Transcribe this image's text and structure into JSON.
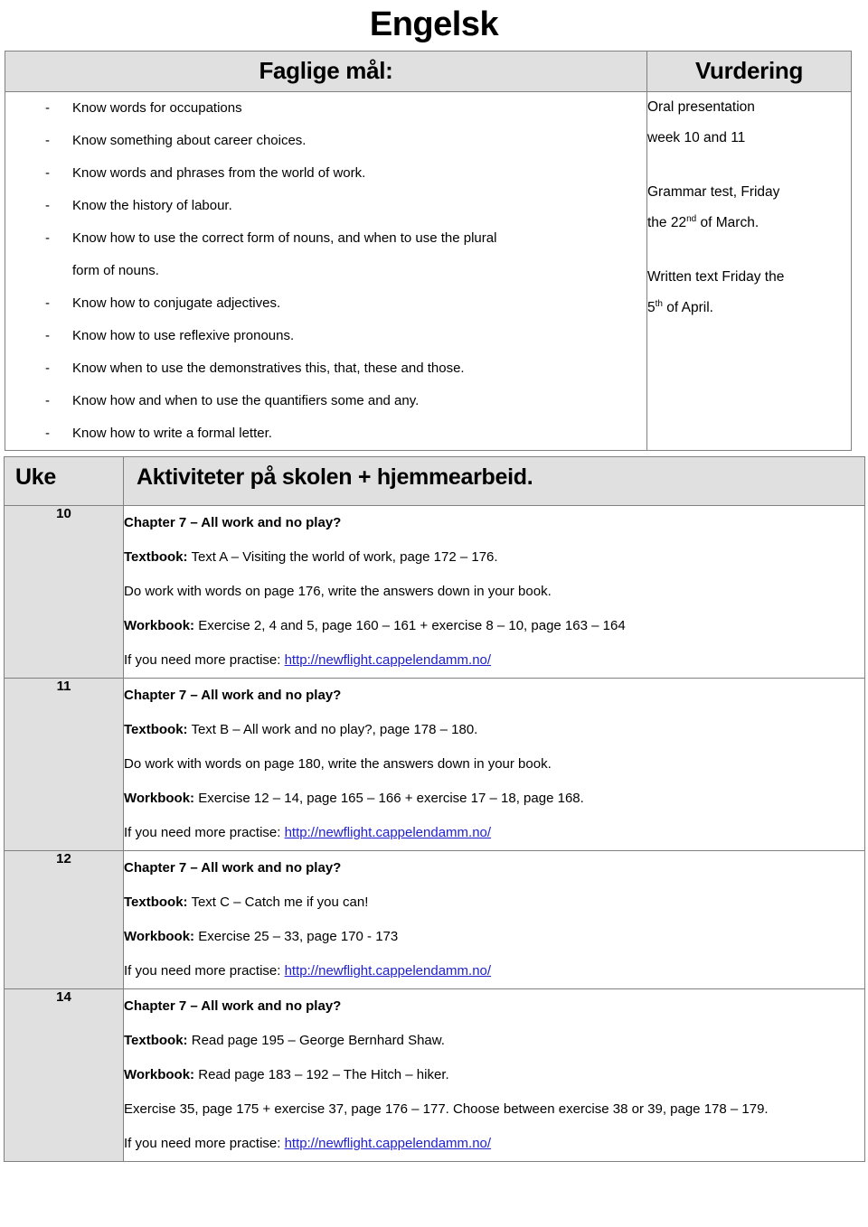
{
  "document": {
    "title": "Engelsk"
  },
  "goals_table": {
    "headers": {
      "goals": "Faglige mål:",
      "assessment": "Vurdering"
    },
    "goals": [
      {
        "text": "Know words for occupations"
      },
      {
        "text": "Know something about career choices."
      },
      {
        "text": "Know words and phrases from the world of work."
      },
      {
        "text": "Know the history of labour."
      },
      {
        "text": "Know how to use the correct form of nouns, and when to use the plural",
        "continuation": "form of nouns."
      },
      {
        "text": "Know how to conjugate adjectives."
      },
      {
        "text": "Know how to use reflexive pronouns."
      },
      {
        "text": "Know when to use the demonstratives this, that, these and those."
      },
      {
        "text": "Know how and when to use the quantifiers some and any."
      },
      {
        "text": "Know how to write a formal letter."
      }
    ],
    "assessments": [
      {
        "line1": "Oral presentation",
        "line2": "week 10 and 11"
      },
      {
        "line1": "Grammar test, Friday",
        "line2_pre": "the 22",
        "line2_sup": "nd",
        "line2_post": " of March."
      },
      {
        "line1": "Written text Friday the",
        "line2_pre": "5",
        "line2_sup": "th",
        "line2_post": " of April."
      }
    ]
  },
  "plan_table": {
    "headers": {
      "week": "Uke",
      "activities": "Aktiviteter på skolen + hjemmearbeid."
    },
    "link_label": "http://newflight.cappelendamm.no/",
    "practise_prefix": "If you need more practise: ",
    "rows": [
      {
        "week": "10",
        "chapter": "Chapter 7 – All work and no play?",
        "textbook_label": "Textbook:",
        "textbook_text": " Text A – Visiting the world of work, page 172 – 176.",
        "extra_line": "Do work with words on page 176, write the answers down in your book.",
        "workbook_label": "Workbook:",
        "workbook_text": " Exercise 2, 4 and 5, page 160 – 161 + exercise 8 – 10, page 163 – 164"
      },
      {
        "week": "11",
        "chapter": "Chapter 7 – All work and no play?",
        "textbook_label": "Textbook:",
        "textbook_text": " Text B – All work and no play?, page 178 – 180.",
        "extra_line": "Do work with words on page 180, write the answers down in your book.",
        "workbook_label": "Workbook:",
        "workbook_text": " Exercise 12 – 14, page 165 – 166 + exercise 17 – 18, page 168."
      },
      {
        "week": "12",
        "chapter": "Chapter 7 – All work and no play?",
        "textbook_label": "Textbook:",
        "textbook_text": " Text C – Catch me if you can!",
        "extra_line": "",
        "workbook_label": "Workbook:",
        "workbook_text": " Exercise 25 – 33, page 170 - 173"
      },
      {
        "week": "14",
        "chapter": "Chapter 7 – All work and no play?",
        "textbook_label": "Textbook:",
        "textbook_text": " Read page 195 – George Bernhard Shaw.",
        "extra_line": "",
        "workbook_label": "Workbook:",
        "workbook_text": " Read page 183 – 192 – The Hitch – hiker.",
        "exercise_line": "Exercise 35, page 175 + exercise 37, page 176 – 177. Choose between exercise 38 or 39, page 178 – 179."
      }
    ]
  },
  "colors": {
    "header_fill": "#e0e0e0",
    "border": "#808080",
    "link": "#2020cc"
  }
}
